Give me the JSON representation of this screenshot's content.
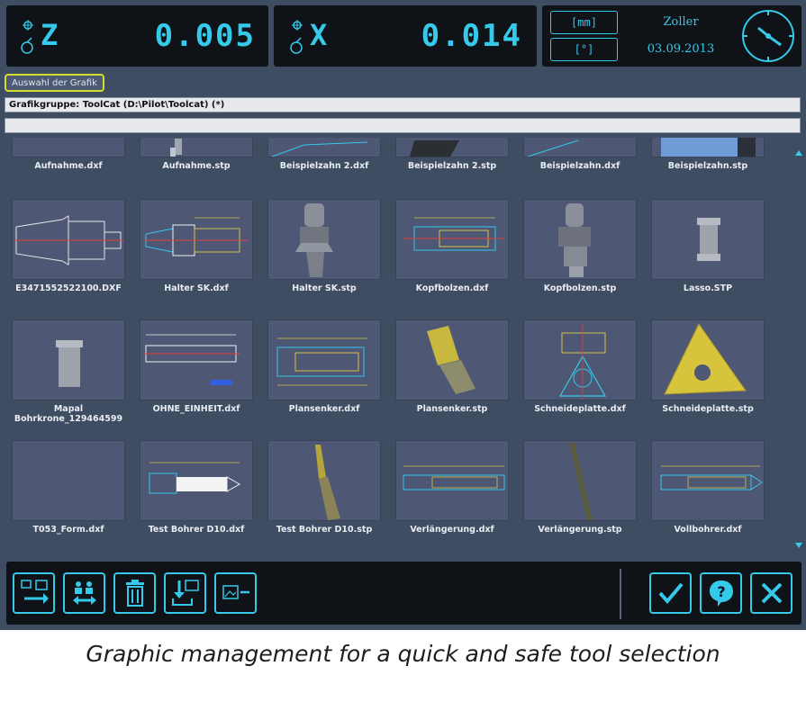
{
  "readouts": [
    {
      "axis": "Z",
      "value": "0.005"
    },
    {
      "axis": "X",
      "value": "0.014"
    }
  ],
  "units": {
    "length": "[mm]",
    "angle": "[°]"
  },
  "info": {
    "brand": "Zoller",
    "date": "03.09.2013"
  },
  "select_button": "Auswahl der Grafik",
  "group_field": "Grafikgruppe: ToolCat  (D:\\Pilot\\Toolcat) (*)",
  "search_field": "",
  "tiles_row0": [
    "Aufnahme.dxf",
    "Aufnahme.stp",
    "Beispielzahn 2.dxf",
    "Beispielzahn 2.stp",
    "Beispielzahn.dxf",
    "Beispielzahn.stp"
  ],
  "tiles_row1": [
    "E3471552522100.DXF",
    "Halter SK.dxf",
    "Halter SK.stp",
    "Kopfbolzen.dxf",
    "Kopfbolzen.stp",
    "Lasso.STP"
  ],
  "tiles_row2": [
    "Mapal Bohrkrone_129464599",
    "OHNE_EINHEIT.dxf",
    "Plansenker.dxf",
    "Plansenker.stp",
    "Schneideplatte.dxf",
    "Schneideplatte.stp"
  ],
  "tiles_row3": [
    "T053_Form.dxf",
    "Test Bohrer D10.dxf",
    "Test Bohrer D10.stp",
    "Verlängerung.dxf",
    "Verlängerung.stp",
    "Vollbohrer.dxf"
  ],
  "toolbar_icons": [
    "import-graphic-icon",
    "transfer-icon",
    "trash-icon",
    "download-graphic-icon",
    "remove-graphic-icon"
  ],
  "confirm_icons": [
    "checkmark-icon",
    "help-icon",
    "close-icon"
  ],
  "caption": "Graphic management for a quick and safe tool selection",
  "colors": {
    "accent": "#35c9ea",
    "panel": "#0f1217",
    "background": "#3f4d63",
    "highlight": "#d3dc2f"
  }
}
